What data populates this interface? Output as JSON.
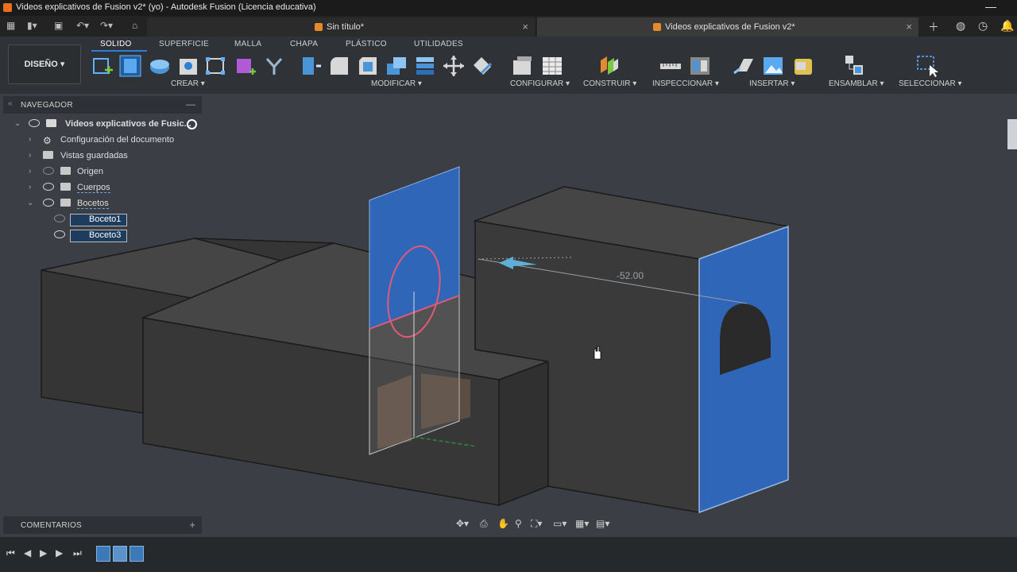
{
  "window": {
    "title": "Videos explicativos de Fusion v2* (yo) - Autodesk Fusion (Licencia educativa)",
    "minimize": "—"
  },
  "tabs": [
    {
      "label": "Sin título*",
      "close": "×"
    },
    {
      "label": "Videos explicativos de Fusion v2*",
      "close": "×"
    }
  ],
  "tabbar_icons": [
    "grid-icon",
    "file-icon",
    "save-icon",
    "undo-icon",
    "redo-icon",
    "home-icon",
    "plus-icon",
    "extensions-icon",
    "clock-icon",
    "bell-icon"
  ],
  "toolbar": {
    "design_label": "DISEÑO ▾",
    "workspace_tabs": [
      "SOLIDO",
      "SUPERFICIE",
      "MALLA",
      "CHAPA",
      "PLÁSTICO",
      "UTILIDADES"
    ],
    "active_workspace": "SOLIDO",
    "groups": [
      "CREAR ▾",
      "MODIFICAR ▾",
      "CONFIGURAR ▾",
      "CONSTRUIR ▾",
      "INSPECCIONAR ▾",
      "INSERTAR ▾",
      "ENSAMBLAR ▾",
      "SELECCIONAR ▾"
    ]
  },
  "navigator": {
    "title": "NAVEGADOR",
    "root": "Videos explicativos de Fusic...",
    "items": [
      {
        "label": "Configuración del documento"
      },
      {
        "label": "Vistas guardadas"
      },
      {
        "label": "Origen"
      },
      {
        "label": "Cuerpos"
      },
      {
        "label": "Bocetos"
      },
      {
        "label": "Boceto1"
      },
      {
        "label": "Boceto3"
      }
    ]
  },
  "comments": {
    "title": "COMENTARIOS",
    "add": "+"
  },
  "viewport": {
    "dimension_value": "-52.00"
  },
  "colors": {
    "accent": "#2a7fd6",
    "face_blue": "#2f66b8",
    "body_gray": "#3a3a3a",
    "sketch_pink": "#e05a7a"
  }
}
